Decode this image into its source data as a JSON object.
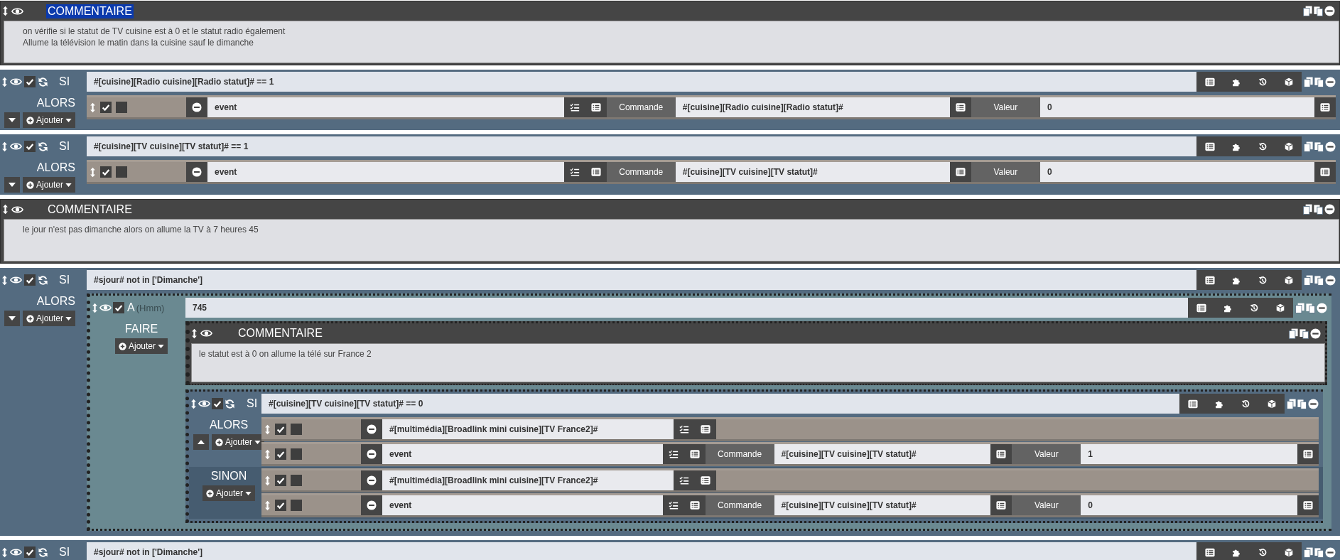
{
  "blocks": [
    {
      "kind": "comment",
      "title": "COMMENTAIRE",
      "title_selected": true,
      "lines": [
        "on vérifie si le statut de TV cuisine est à 0 et le statut radio également",
        "Allume la télévision le matin dans la cuisine sauf le dimanche"
      ]
    },
    {
      "kind": "if",
      "enabled": true,
      "label": "SI",
      "condition": "#[cuisine][Radio cuisine][Radio statut]# == 1",
      "then_label": "ALORS",
      "add_label": "Ajouter",
      "expanded": false,
      "then": [
        {
          "kind": "event",
          "enabled": true,
          "parallel": false,
          "command": "event",
          "command_label": "Commande",
          "command_value": "#[cuisine][Radio cuisine][Radio statut]#",
          "value_label": "Valeur",
          "value": "0"
        }
      ]
    },
    {
      "kind": "if",
      "enabled": true,
      "label": "SI",
      "condition": "#[cuisine][TV cuisine][TV statut]# == 1",
      "then_label": "ALORS",
      "add_label": "Ajouter",
      "expanded": false,
      "then": [
        {
          "kind": "event",
          "enabled": true,
          "parallel": false,
          "command": "event",
          "command_label": "Commande",
          "command_value": "#[cuisine][TV cuisine][TV statut]#",
          "value_label": "Valeur",
          "value": "0"
        }
      ]
    },
    {
      "kind": "comment",
      "title": "COMMENTAIRE",
      "title_selected": false,
      "lines": [
        "le jour n'est pas dimanche alors on allume la TV à 7 heures 45"
      ]
    },
    {
      "kind": "if",
      "enabled": true,
      "label": "SI",
      "condition": "#sjour# not in ['Dimanche']",
      "then_label": "ALORS",
      "add_label": "Ajouter",
      "expanded": false,
      "then": [
        {
          "kind": "at",
          "enabled": true,
          "label": "A",
          "hint": "(Hmm)",
          "time": "745",
          "do_label": "FAIRE",
          "add_label": "Ajouter",
          "do": [
            {
              "kind": "comment",
              "title": "COMMENTAIRE",
              "title_selected": false,
              "lines": [
                "le statut est à 0 on allume la télé sur France 2"
              ]
            },
            {
              "kind": "if",
              "enabled": true,
              "label": "SI",
              "condition": "#[cuisine][TV cuisine][TV statut]# == 0",
              "then_label": "ALORS",
              "add_label": "Ajouter",
              "expanded": true,
              "then": [
                {
                  "kind": "command",
                  "enabled": true,
                  "parallel": false,
                  "command": "#[multimédia][Broadlink mini cuisine][TV France2]#"
                },
                {
                  "kind": "event",
                  "enabled": true,
                  "parallel": false,
                  "command": "event",
                  "command_label": "Commande",
                  "command_value": "#[cuisine][TV cuisine][TV statut]#",
                  "value_label": "Valeur",
                  "value": "1"
                }
              ],
              "else_label": "SINON",
              "else_add_label": "Ajouter",
              "else": [
                {
                  "kind": "command",
                  "enabled": true,
                  "parallel": false,
                  "command": "#[multimédia][Broadlink mini cuisine][TV France2]#"
                },
                {
                  "kind": "event",
                  "enabled": true,
                  "parallel": false,
                  "command": "event",
                  "command_label": "Commande",
                  "command_value": "#[cuisine][TV cuisine][TV statut]#",
                  "value_label": "Valeur",
                  "value": "0"
                }
              ]
            }
          ]
        }
      ]
    },
    {
      "kind": "if",
      "enabled": true,
      "label": "SI",
      "condition": "#sjour# not in ['Dimanche']"
    }
  ]
}
